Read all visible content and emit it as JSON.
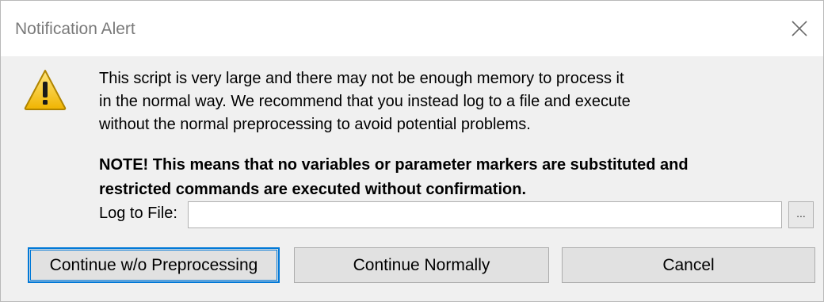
{
  "window": {
    "title": "Notification Alert",
    "close_icon": "close-icon"
  },
  "message": {
    "icon": "warning-icon",
    "lines": [
      "This script is very large and there may not be enough memory to process it",
      "in the normal way. We recommend that you instead log to a file and execute",
      "without the normal preprocessing to avoid potential problems."
    ],
    "note_lines": [
      "NOTE! This means that no variables or parameter markers are substituted and",
      "restricted commands are executed without confirmation."
    ]
  },
  "log": {
    "label": "Log to File:",
    "value": "",
    "browse_label": "..."
  },
  "buttons": {
    "continue_no_preprocessing": "Continue w/o Preprocessing",
    "continue_normally": "Continue Normally",
    "cancel": "Cancel"
  },
  "colors": {
    "accent": "#0078d7",
    "warning_fill": "#f5c518"
  }
}
